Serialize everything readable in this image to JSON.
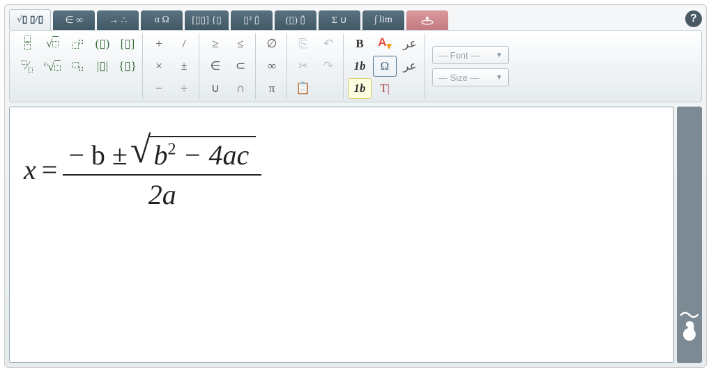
{
  "tabs": [
    {
      "id": "math-basic",
      "label": "√▯ ▯/▯"
    },
    {
      "id": "symbols",
      "label": "∈ ∞"
    },
    {
      "id": "arrows",
      "label": "→ ∴"
    },
    {
      "id": "greek",
      "label": "α Ω"
    },
    {
      "id": "matrix",
      "label": "[▯▯] {▯"
    },
    {
      "id": "scripts",
      "label": "▯² ▯̇"
    },
    {
      "id": "brackets",
      "label": "(▯) ▯̂"
    },
    {
      "id": "bigops",
      "label": "Σ ∪"
    },
    {
      "id": "calc",
      "label": "∫ lim"
    }
  ],
  "help": "?",
  "toolbar": {
    "templates": {
      "r1": [
        "▯/▯",
        "√▯",
        "▯²",
        "(▯)",
        "[▯]"
      ],
      "r2": [
        "▯/▯",
        "ⁿ√▯",
        "▯ₙ",
        "|▯|",
        "{▯}"
      ]
    },
    "ops": {
      "r1": [
        "+",
        "/"
      ],
      "r2": [
        "×",
        "±"
      ],
      "r3": [
        "−",
        "÷"
      ]
    },
    "rel": {
      "r1": [
        "≥",
        "≤"
      ],
      "r2": [
        "∈",
        "⊂"
      ],
      "r3": [
        "∪",
        "∩"
      ]
    },
    "sym": {
      "r1": [
        "∅"
      ],
      "r2": [
        "∞"
      ],
      "r3": [
        "π"
      ]
    },
    "edit": {
      "copy": "⎘",
      "undo": "↶",
      "cut": "✂",
      "redo": "↷",
      "paste": "📋"
    },
    "format": {
      "bold": "B",
      "color": "A",
      "rtl1": "ﻋﺮ",
      "italic": "1b",
      "omega": "Ω",
      "rtl2": "ﻋﺮ",
      "italic2": "1b",
      "textmode": "T|"
    },
    "font_dd": "— Font —",
    "size_dd": "— Size —"
  },
  "equation": {
    "lhs": "x",
    "eq": "=",
    "num_prefix": "− b ±",
    "sqrt_inner_b": "b",
    "sqrt_inner_exp": "2",
    "sqrt_inner_rest": "− 4ac",
    "den": "2a"
  }
}
